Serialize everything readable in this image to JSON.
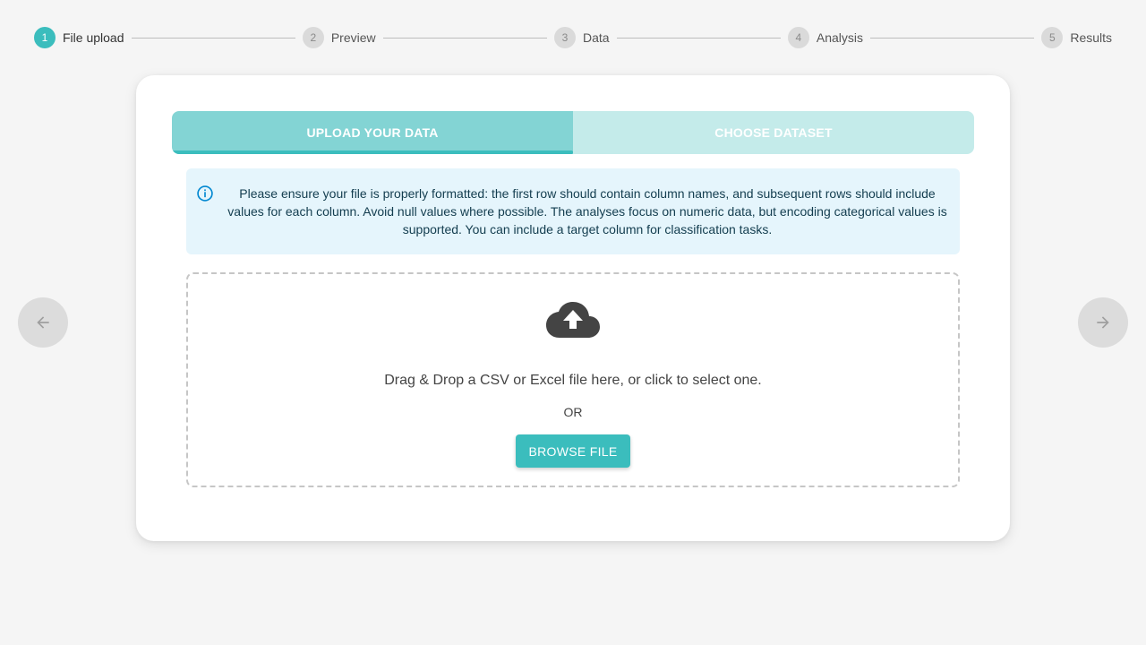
{
  "stepper": {
    "steps": [
      {
        "number": "1",
        "label": "File upload",
        "state": "active"
      },
      {
        "number": "2",
        "label": "Preview",
        "state": "inactive"
      },
      {
        "number": "3",
        "label": "Data",
        "state": "inactive"
      },
      {
        "number": "4",
        "label": "Analysis",
        "state": "inactive"
      },
      {
        "number": "5",
        "label": "Results",
        "state": "inactive"
      }
    ]
  },
  "navigation": {
    "prev_icon": "arrow-left-icon",
    "next_icon": "arrow-right-icon"
  },
  "tabs": [
    {
      "label": "UPLOAD YOUR DATA",
      "selected": true
    },
    {
      "label": "CHOOSE DATASET",
      "selected": false
    }
  ],
  "info_alert": {
    "icon": "info-icon",
    "text": "Please ensure your file is properly formatted: the first row should contain column names, and subsequent rows should include values for each column. Avoid null values where possible. The analyses focus on numeric data, but encoding categorical values is supported. You can include a target column for classification tasks."
  },
  "dropzone": {
    "icon": "cloud-upload-icon",
    "instruction": "Drag & Drop a CSV or Excel file here, or click to select one.",
    "or_text": "OR",
    "browse_label": "BROWSE FILE"
  },
  "colors": {
    "accent": "#3bbdbd",
    "tab_selected": "#83d4d4",
    "tab_unselected": "#c4ebea",
    "alert_bg": "#e5f5fc",
    "background": "#f5f5f5"
  }
}
